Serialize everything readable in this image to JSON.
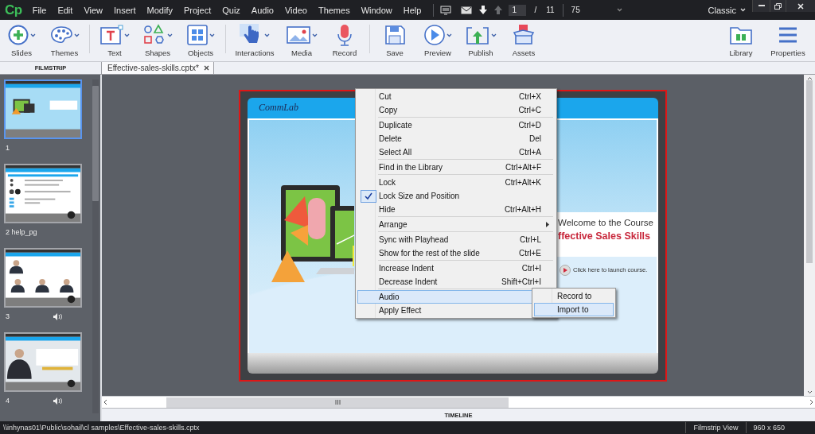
{
  "app": {
    "logo": "Cp"
  },
  "menu_bar": [
    "File",
    "Edit",
    "View",
    "Insert",
    "Modify",
    "Project",
    "Quiz",
    "Audio",
    "Video",
    "Themes",
    "Window",
    "Help"
  ],
  "slide_nav": {
    "current": "1",
    "separator": "/",
    "total": "11",
    "zoom": "75"
  },
  "workspace": "Classic",
  "toolbar": {
    "groups": [
      [
        {
          "label": "Slides",
          "has_menu": true
        },
        {
          "label": "Themes",
          "has_menu": true
        }
      ],
      [
        {
          "label": "Text",
          "has_menu": true
        },
        {
          "label": "Shapes",
          "has_menu": true
        },
        {
          "label": "Objects",
          "has_menu": true
        }
      ],
      [
        {
          "label": "Interactions",
          "has_menu": true
        },
        {
          "label": "Media",
          "has_menu": true
        },
        {
          "label": "Record",
          "has_menu": false
        }
      ],
      [
        {
          "label": "Save",
          "has_menu": false
        },
        {
          "label": "Preview",
          "has_menu": true
        },
        {
          "label": "Publish",
          "has_menu": true
        },
        {
          "label": "Assets",
          "has_menu": false
        }
      ]
    ],
    "right": [
      {
        "label": "Library",
        "has_menu": false
      },
      {
        "label": "Properties",
        "has_menu": false
      }
    ]
  },
  "filmstrip": {
    "header": "FILMSTRIP",
    "slides": [
      {
        "label": "1",
        "selected": true,
        "audio": false
      },
      {
        "label": "2 help_pg",
        "selected": false,
        "audio": false
      },
      {
        "label": "3",
        "selected": false,
        "audio": true
      },
      {
        "label": "4",
        "selected": false,
        "audio": true
      }
    ]
  },
  "tabs": [
    {
      "label": "Effective-sales-skills.cptx*",
      "selected": true
    }
  ],
  "slide": {
    "logo": "CommLab",
    "heading": "Welcome to the Course",
    "title": "ffective Sales Skills",
    "link": "Click here to launch course."
  },
  "context_menu": {
    "groups": [
      [
        {
          "label": "Cut",
          "shortcut": "Ctrl+X",
          "checked": false,
          "has_submenu": false,
          "highlighted": false
        },
        {
          "label": "Copy",
          "shortcut": "Ctrl+C",
          "checked": false,
          "has_submenu": false,
          "highlighted": false
        }
      ],
      [
        {
          "label": "Duplicate",
          "shortcut": "Ctrl+D",
          "checked": false,
          "has_submenu": false,
          "highlighted": false
        },
        {
          "label": "Delete",
          "shortcut": "Del",
          "checked": false,
          "has_submenu": false,
          "highlighted": false
        },
        {
          "label": "Select All",
          "shortcut": "Ctrl+A",
          "checked": false,
          "has_submenu": false,
          "highlighted": false
        }
      ],
      [
        {
          "label": "Find in the Library",
          "shortcut": "Ctrl+Alt+F",
          "checked": false,
          "has_submenu": false,
          "highlighted": false
        }
      ],
      [
        {
          "label": "Lock",
          "shortcut": "Ctrl+Alt+K",
          "checked": false,
          "has_submenu": false,
          "highlighted": false
        },
        {
          "label": "Lock Size and Position",
          "checked": true,
          "has_submenu": false,
          "highlighted": false
        },
        {
          "label": "Hide",
          "shortcut": "Ctrl+Alt+H",
          "checked": false,
          "has_submenu": false,
          "highlighted": false
        }
      ],
      [
        {
          "label": "Arrange",
          "checked": false,
          "has_submenu": true,
          "highlighted": false
        }
      ],
      [
        {
          "label": "Sync with Playhead",
          "shortcut": "Ctrl+L",
          "checked": false,
          "has_submenu": false,
          "highlighted": false
        },
        {
          "label": "Show for the rest of the slide",
          "shortcut": "Ctrl+E",
          "checked": false,
          "has_submenu": false,
          "highlighted": false
        }
      ],
      [
        {
          "label": "Increase Indent",
          "shortcut": "Ctrl+I",
          "checked": false,
          "has_submenu": false,
          "highlighted": false
        },
        {
          "label": "Decrease Indent",
          "shortcut": "Shift+Ctrl+I",
          "checked": false,
          "has_submenu": false,
          "highlighted": false
        }
      ],
      [
        {
          "label": "Audio",
          "checked": false,
          "has_submenu": true,
          "highlighted": true
        },
        {
          "label": "Apply Effect",
          "checked": false,
          "has_submenu": false,
          "highlighted": false
        }
      ]
    ]
  },
  "submenu": {
    "items": [
      {
        "label": "Record to",
        "highlighted": false
      },
      {
        "label": "Import to",
        "highlighted": true
      }
    ]
  },
  "timeline": "TIMELINE",
  "status_bar": {
    "path": "\\\\inhynas01\\Public\\sohail\\cl samples\\Effective-sales-skills.cptx",
    "view": "Filmstrip View",
    "size": "960 x 650"
  }
}
